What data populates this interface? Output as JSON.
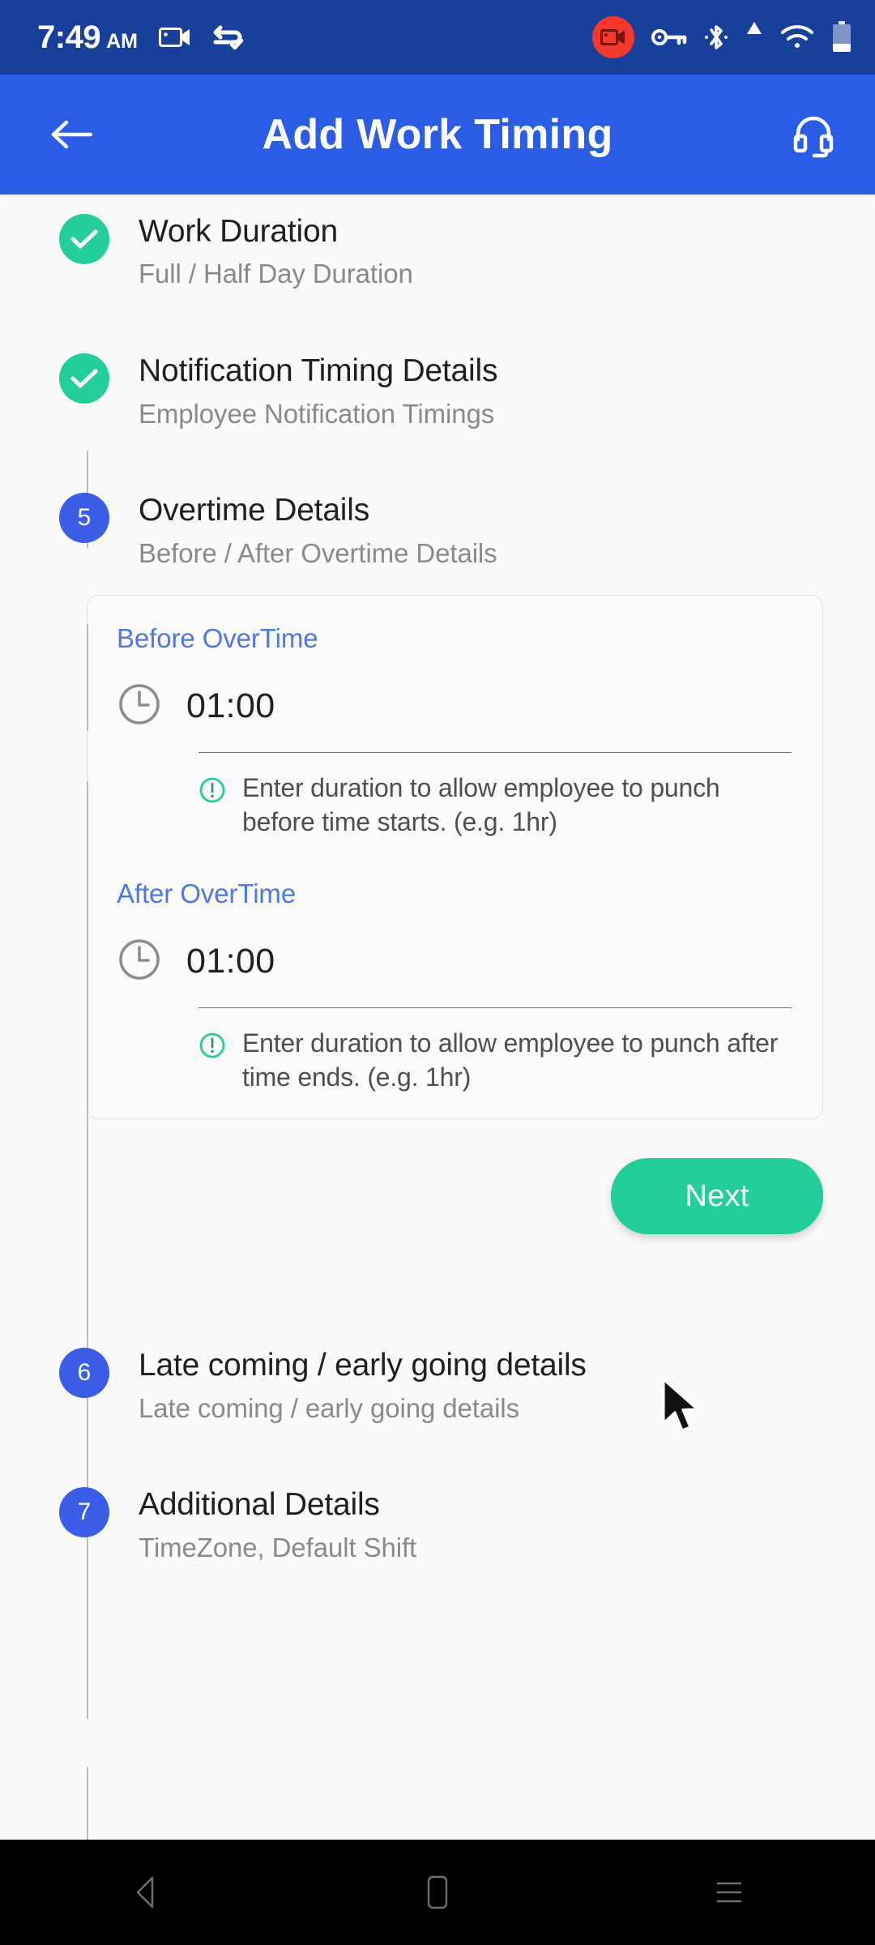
{
  "status_bar": {
    "time": "7:49",
    "ampm": "AM",
    "icons": [
      "screen-record-icon",
      "sync-check-icon",
      "recording-badge-icon",
      "vpn-key-icon",
      "bluetooth-icon",
      "signal-icon",
      "wifi-icon",
      "battery-icon"
    ],
    "background": "#18409B"
  },
  "app_bar": {
    "title": "Add Work Timing",
    "back_icon": "arrow-left-icon",
    "support_icon": "headset-icon",
    "background": "#2B5CE5"
  },
  "stepper": {
    "steps": [
      {
        "marker": "check",
        "number": "",
        "title": "Work Duration",
        "subtitle": "Full / Half Day Duration",
        "state": "done"
      },
      {
        "marker": "check",
        "number": "",
        "title": "Notification Timing Details",
        "subtitle": "Employee Notification Timings",
        "state": "done"
      },
      {
        "marker": "number",
        "number": "5",
        "title": "Overtime Details",
        "subtitle": "Before / After Overtime Details",
        "state": "active"
      },
      {
        "marker": "number",
        "number": "6",
        "title": "Late coming / early going details",
        "subtitle": "Late coming / early going details",
        "state": "pending"
      },
      {
        "marker": "number",
        "number": "7",
        "title": "Additional Details",
        "subtitle": "TimeZone, Default Shift",
        "state": "pending"
      }
    ]
  },
  "overtime_panel": {
    "before": {
      "label": "Before OverTime",
      "icon": "clock-icon",
      "value": "01:00",
      "hint_icon": "info-exclamation-icon",
      "hint": "Enter duration to allow employee to punch before time starts. (e.g. 1hr)"
    },
    "after": {
      "label": "After OverTime",
      "icon": "clock-icon",
      "value": "01:00",
      "hint_icon": "info-exclamation-icon",
      "hint": "Enter duration to allow employee to punch after time ends. (e.g. 1hr)"
    },
    "next_button": "Next"
  },
  "nav_bar": {
    "back": "nav-back-icon",
    "home": "nav-home-icon",
    "recents": "nav-recents-icon"
  },
  "colors": {
    "status_bar_blue": "#18409B",
    "app_bar_blue": "#2B5CE5",
    "accent_green": "#24CE9B",
    "step_blue": "#3B5DE7",
    "link_blue": "#5277E4",
    "record_red": "#F2392B"
  }
}
